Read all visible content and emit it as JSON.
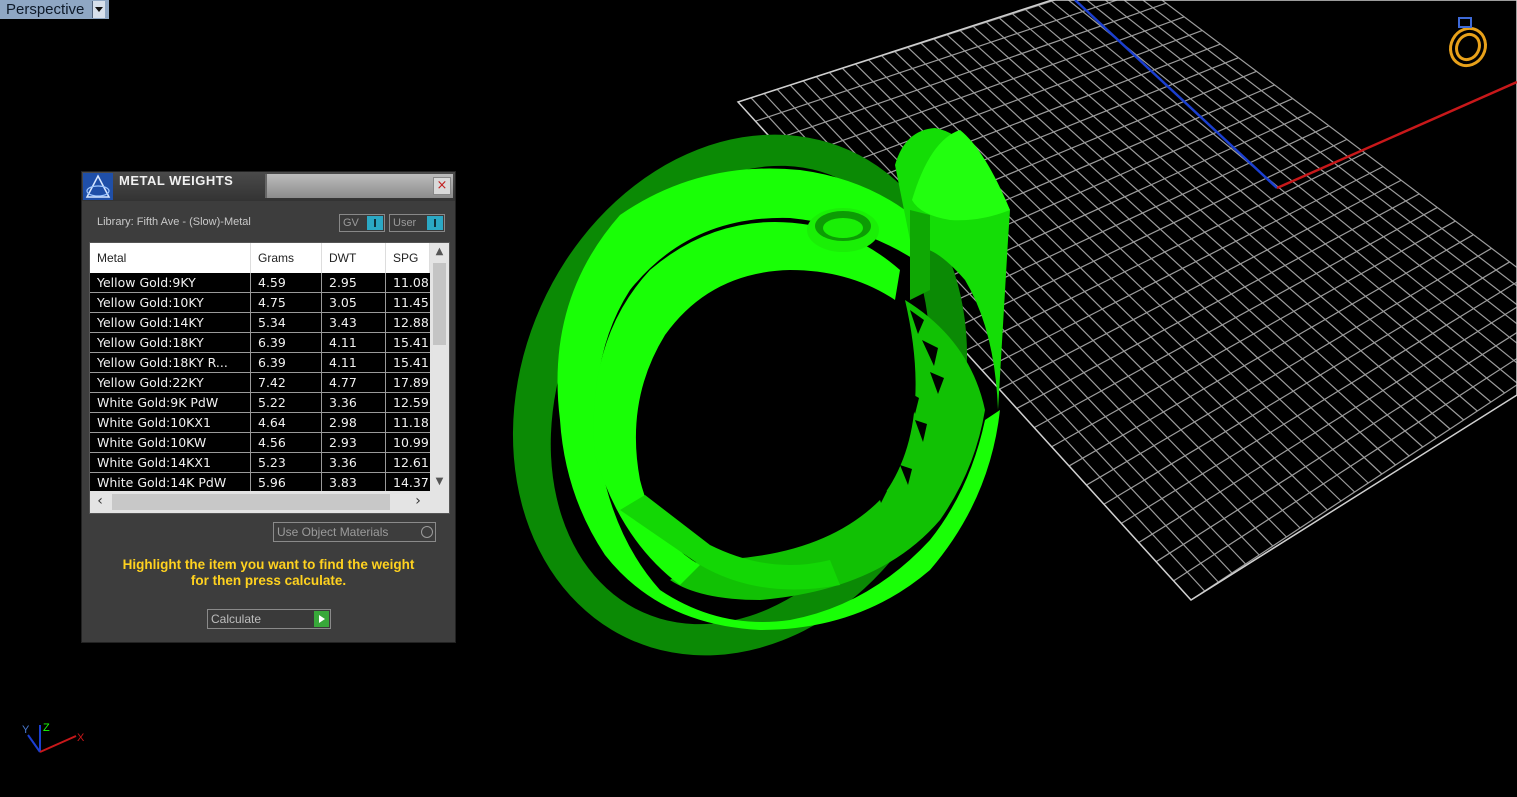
{
  "viewport": {
    "name": "Perspective"
  },
  "gizmo": {
    "z_label": "Z",
    "y_label": "Y",
    "x_label": "X"
  },
  "dialog": {
    "title": "METAL WEIGHTS",
    "close_glyph": "×",
    "library_label": "Library: Fifth Ave - (Slow)-Metal",
    "toggle_gv": "GV",
    "toggle_user": "User",
    "columns": [
      "Metal",
      "Grams",
      "DWT",
      "SPG"
    ],
    "rows": [
      [
        "Yellow Gold:9KY",
        "4.59",
        "2.95",
        "11.08"
      ],
      [
        "Yellow Gold:10KY",
        "4.75",
        "3.05",
        "11.45"
      ],
      [
        "Yellow Gold:14KY",
        "5.34",
        "3.43",
        "12.88"
      ],
      [
        "Yellow Gold:18KY",
        "6.39",
        "4.11",
        "15.41"
      ],
      [
        "Yellow Gold:18KY R...",
        "6.39",
        "4.11",
        "15.41"
      ],
      [
        "Yellow Gold:22KY",
        "7.42",
        "4.77",
        "17.89"
      ],
      [
        "White Gold:9K PdW",
        "5.22",
        "3.36",
        "12.59"
      ],
      [
        "White Gold:10KX1",
        "4.64",
        "2.98",
        "11.18"
      ],
      [
        "White Gold:10KW",
        "4.56",
        "2.93",
        "10.99"
      ],
      [
        "White Gold:14KX1",
        "5.23",
        "3.36",
        "12.61"
      ],
      [
        "White Gold:14K PdW",
        "5.96",
        "3.83",
        "14.37"
      ]
    ],
    "object_materials": "Use Object Materials",
    "hint_line1": "Highlight the item you want to find the weight",
    "hint_line2": "for then press calculate.",
    "calculate": "Calculate"
  },
  "colors": {
    "ring": "#19ff06",
    "grid": "#bdbdbd",
    "axis_x": "#c8181a",
    "axis_y": "#1b3fd0",
    "hint": "#ffd21f",
    "ring_icon": "#e8a11a"
  },
  "icons": [
    "app-logo-icon",
    "close-icon",
    "ring-icon",
    "axis-gizmo-icon",
    "dropdown-arrow-icon",
    "play-arrow-icon"
  ]
}
